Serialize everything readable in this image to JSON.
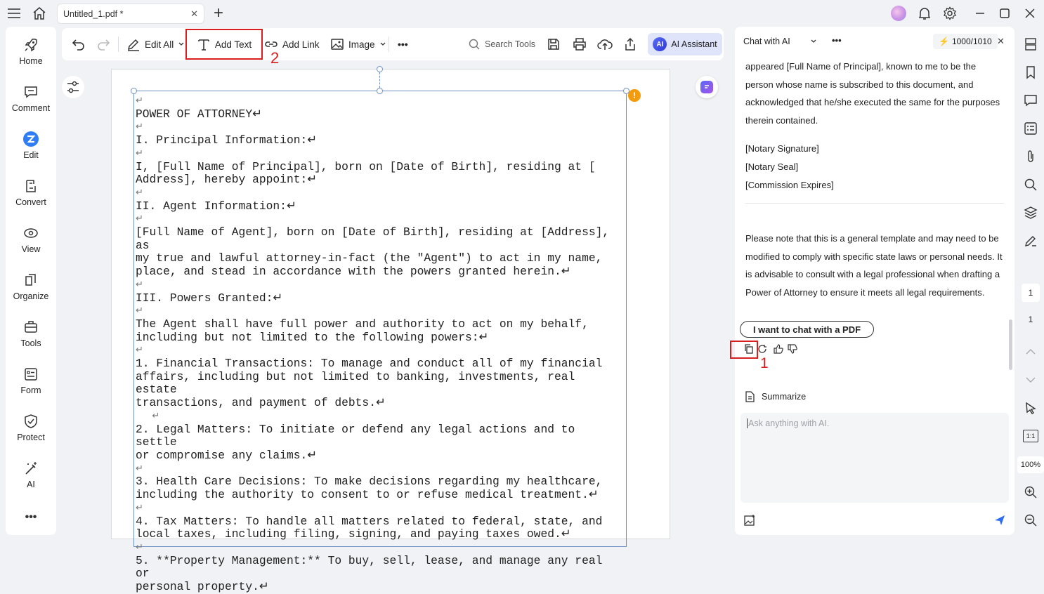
{
  "titlebar": {
    "tab_title": "Untitled_1.pdf *",
    "tab_close": "✕",
    "new_tab": "+"
  },
  "leftbar": {
    "items": [
      {
        "label": "Home",
        "icon": "rocket-icon"
      },
      {
        "label": "Comment",
        "icon": "comment-icon"
      },
      {
        "label": "Edit",
        "icon": "edit-icon"
      },
      {
        "label": "Convert",
        "icon": "convert-icon"
      },
      {
        "label": "View",
        "icon": "view-icon"
      },
      {
        "label": "Organize",
        "icon": "organize-icon"
      },
      {
        "label": "Tools",
        "icon": "tools-icon"
      },
      {
        "label": "Form",
        "icon": "form-icon"
      },
      {
        "label": "Protect",
        "icon": "protect-icon"
      },
      {
        "label": "AI",
        "icon": "ai-wand-icon"
      }
    ],
    "more": "•••"
  },
  "toolbar": {
    "edit_all": "Edit All",
    "add_text": "Add Text",
    "add_link": "Add Link",
    "image": "Image",
    "more": "•••",
    "search_tools": "Search Tools",
    "ai_assistant": "AI Assistant",
    "ai_badge": "AI"
  },
  "annotations": {
    "label_1": "1",
    "label_2": "2"
  },
  "document": {
    "lines": [
      "↵",
      "POWER OF ATTORNEY↵",
      "↵",
      "I. Principal Information:↵",
      "↵",
      "I, [Full Name of Principal], born on [Date of Birth], residing at [",
      "Address], hereby appoint:↵",
      "↵",
      "II. Agent Information:↵",
      "↵",
      "[Full Name of Agent], born on [Date of Birth], residing at [Address], as",
      "my true and lawful attorney-in-fact (the \"Agent\") to act in my name,",
      "place, and stead in accordance with the powers granted herein.↵",
      "↵",
      "III. Powers Granted:↵",
      "↵",
      "The Agent shall have full power and authority to act on my behalf,",
      "including but not limited to the following powers:↵",
      "↵",
      "1. Financial Transactions: To manage and conduct all of my financial",
      "affairs, including but not limited to banking, investments, real estate",
      "transactions, and payment of debts.↵",
      "   ↵",
      "2. Legal Matters: To initiate or defend any legal actions and to settle",
      "or compromise any claims.↵",
      "↵",
      "3. Health Care Decisions: To make decisions regarding my healthcare,",
      "including the authority to consent to or refuse medical treatment.↵",
      "↵",
      "4. Tax Matters: To handle all matters related to federal, state, and",
      "local taxes, including filing, signing, and paying taxes owed.↵",
      "↵",
      "5. **Property Management:** To buy, sell, lease, and manage any real or",
      "personal property.↵"
    ],
    "warning": "!"
  },
  "chat": {
    "mode": "Chat with AI",
    "more": "•••",
    "credits": "1000/1010",
    "close": "✕",
    "para1": "appeared [Full Name of Principal], known to me to be the person whose name is subscribed to this document, and acknowledged that he/she executed the same for the purposes therein contained.",
    "notary_signature": "[Notary Signature]",
    "notary_seal": "[Notary Seal]",
    "commission": "[Commission Expires]",
    "para2": "Please note that this is a general template and may need to be modified to comply with specific state laws or personal needs. It is advisable to consult with a legal professional when drafting a Power of Attorney to ensure it meets all legal requirements.",
    "chip": "I want to chat with a PDF",
    "summarize": "Summarize",
    "input_placeholder": "Ask anything with AI."
  },
  "rail": {
    "page_current": "1",
    "page_total": "1",
    "zoom": "100%",
    "fit": "1:1"
  },
  "colors": {
    "accent_red": "#d81e1e",
    "ai_blue": "#2c39d8",
    "warning_orange": "#f39b0b"
  }
}
